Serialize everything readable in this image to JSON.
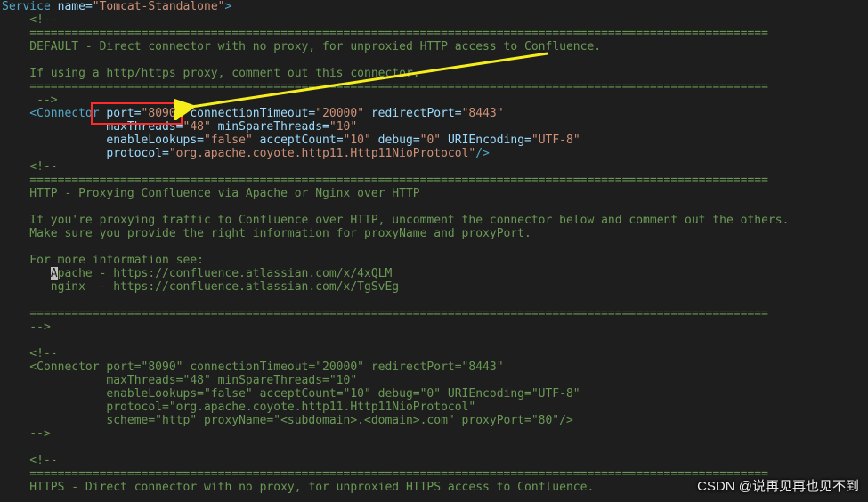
{
  "code": {
    "l1_service": "Service",
    "l1_name_attr": "name",
    "l1_name_val": "\"Tomcat-Standalone\"",
    "l2_open": "    <!--",
    "l3_bar": "    ==========================================================================================================",
    "l4": "    DEFAULT - Direct connector with no proxy, for unproxied HTTP access to Confluence.",
    "l5": "",
    "l6": "    If using a http/https proxy, comment out this connector.",
    "l7_bar": "    ==========================================================================================================",
    "l8_close": "     -->",
    "l9_tag": "    <Connector",
    "l9_port_attr": " port",
    "l9_port_val": "\"8090\"",
    "l9_ct_attr": " connectionTimeout",
    "l9_ct_val": "\"20000\"",
    "l9_rp_attr": " redirectPort",
    "l9_rp_val": "\"8443\"",
    "l10_mt_attr": "               maxThreads",
    "l10_mt_val": "\"48\"",
    "l10_mst_attr": " minSpareThreads",
    "l10_mst_val": "\"10\"",
    "l11_el_attr": "               enableLookups",
    "l11_el_val": "\"false\"",
    "l11_ac_attr": " acceptCount",
    "l11_ac_val": "\"10\"",
    "l11_dbg_attr": " debug",
    "l11_dbg_val": "\"0\"",
    "l11_uri_attr": " URIEncoding",
    "l11_uri_val": "\"UTF-8\"",
    "l12_proto_attr": "               protocol",
    "l12_proto_val": "\"org.apache.coyote.http11.Http11NioProtocol\"",
    "l12_close": "/>",
    "l13_open": "    <!--",
    "l14_bar": "    ==========================================================================================================",
    "l15": "    HTTP - Proxying Confluence via Apache or Nginx over HTTP",
    "l16": "",
    "l17": "    If you're proxying traffic to Confluence over HTTP, uncomment the connector below and comment out the others.",
    "l18": "    Make sure you provide the right information for proxyName and proxyPort.",
    "l19": "",
    "l20": "    For more information see:",
    "l21a": "       ",
    "l21_cursor": "A",
    "l21b": "pache - https://confluence.atlassian.com/x/4xQLM",
    "l22": "       nginx  - https://confluence.atlassian.com/x/TgSvEg",
    "l23": "",
    "l24_bar": "    ==========================================================================================================",
    "l25_close": "    -->",
    "l26": "",
    "l27_open": "    <!--",
    "l28": "    <Connector port=\"8090\" connectionTimeout=\"20000\" redirectPort=\"8443\"",
    "l29": "               maxThreads=\"48\" minSpareThreads=\"10\"",
    "l30": "               enableLookups=\"false\" acceptCount=\"10\" debug=\"0\" URIEncoding=\"UTF-8\"",
    "l31": "               protocol=\"org.apache.coyote.http11.Http11NioProtocol\"",
    "l32": "               scheme=\"http\" proxyName=\"<subdomain>.<domain>.com\" proxyPort=\"80\"/>",
    "l33_close": "    -->",
    "l34": "",
    "l35_open": "    <!--",
    "l36_bar": "    ==========================================================================================================",
    "l37": "    HTTPS - Direct connector with no proxy, for unproxied HTTPS access to Confluence.",
    "eq": "="
  },
  "watermark": "CSDN @说再见再也见不到"
}
